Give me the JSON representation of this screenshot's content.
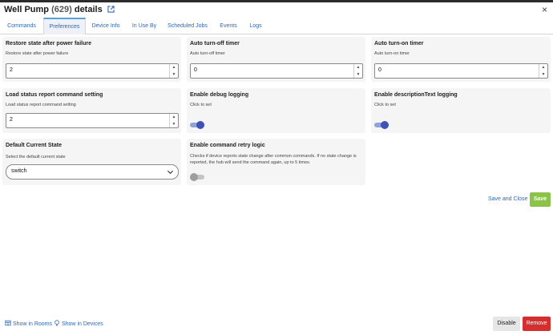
{
  "header": {
    "device_name": "Well Pump",
    "device_id": "(629)",
    "suffix": "details",
    "close_glyph": "×"
  },
  "tabs": [
    {
      "label": "Commands"
    },
    {
      "label": "Preferences",
      "active": true
    },
    {
      "label": "Device Info"
    },
    {
      "label": "In Use By"
    },
    {
      "label": "Scheduled Jobs"
    },
    {
      "label": "Events"
    },
    {
      "label": "Logs"
    }
  ],
  "preferences": {
    "restore_state": {
      "title": "Restore state after power failure",
      "desc": "Restore state after power failure",
      "value": "2"
    },
    "auto_off": {
      "title": "Auto turn-off timer",
      "desc": "Auto turn-off timer",
      "value": "0"
    },
    "auto_on": {
      "title": "Auto turn-on timer",
      "desc": "Auto turn-on timer",
      "value": "0"
    },
    "load_status": {
      "title": "Load status report command setting",
      "desc": "Load status report command setting",
      "value": "2"
    },
    "debug_logging": {
      "title": "Enable debug logging",
      "desc": "Click to set",
      "enabled": true
    },
    "desc_logging": {
      "title": "Enable descriptionText logging",
      "desc": "Click to set",
      "enabled": true
    },
    "default_state": {
      "title": "Default Current State",
      "desc": "Select the default current state",
      "value": "switch"
    },
    "retry_logic": {
      "title": "Enable command retry logic",
      "desc": "Checks if device reports state change after common commands. If no state change is reported, the hub will send the command again, up to 5 times.",
      "enabled": false
    }
  },
  "actions": {
    "save_close": "Save and Close",
    "save": "Save",
    "disable": "Disable",
    "remove": "Remove"
  },
  "footer": {
    "show_rooms": "Show in Rooms",
    "show_devices": "Show in Devices"
  },
  "colors": {
    "link": "#2f66b3",
    "save": "#8bc34a",
    "remove": "#d32f2f",
    "toggle_on": "#3f51b5"
  }
}
